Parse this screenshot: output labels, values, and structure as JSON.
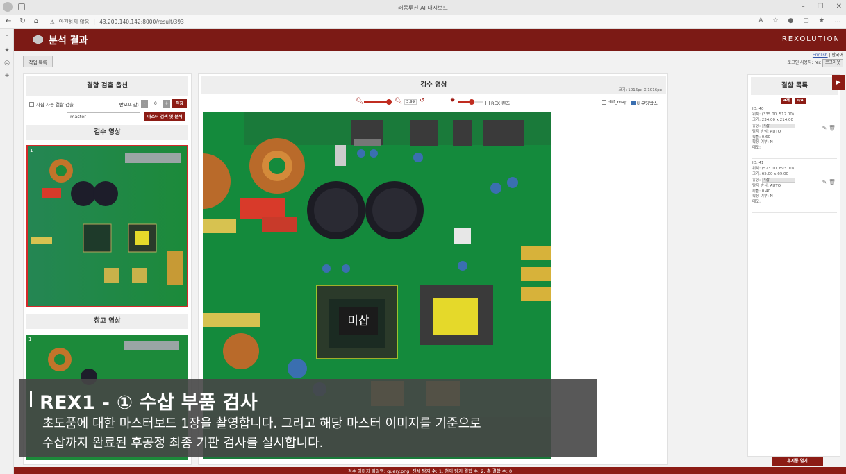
{
  "browser": {
    "tab_title": "래몽루션 AI 대시보드",
    "security_label": "안전하지 않음",
    "url": "43.200.140.142:8000/result/393"
  },
  "header": {
    "title": "분석 결과",
    "brand": "REXOLUTION"
  },
  "toolbar": {
    "job_list_label": "작업 목록"
  },
  "user": {
    "lang_en": "English",
    "lang_sep": " | ",
    "lang_ko": "한국어",
    "login_label": "로그인 사용자: rex",
    "logout_label": "로그아웃"
  },
  "options": {
    "title": "결함 검출 옵션",
    "auto_checkbox_label": "자삽 자동 결함 검출",
    "threshold_label": "반오프 값:",
    "threshold_minus": "-",
    "threshold_value": "0",
    "threshold_plus": "+",
    "save_label": "저장",
    "master_value": "master",
    "search_analyze_label": "마스터 검색 및 분석"
  },
  "inspection": {
    "title": "검수 영상",
    "index": "1"
  },
  "reference": {
    "title": "참고 영상",
    "index": "1"
  },
  "viewer": {
    "title": "검수 영상",
    "size_label": "크기: 1016px X 1016px",
    "zoom_value": "3.99",
    "rex_lens_label": "REX 렌즈",
    "diff_map_label": "diff_map",
    "bbox_label": "바운딩박스",
    "defect_overlay_text": "미삽"
  },
  "defects": {
    "title": "결함 목록",
    "count_badge": "4개",
    "page_badge": "1/4",
    "items": [
      {
        "id": "ID: 40",
        "position": "위치: (335.00, 512.00)",
        "size": "크기: 234.00 x 214.00",
        "type_label": "유형:",
        "type_value": "미삽",
        "method": "탐지 방식: AUTO",
        "prob": "확률: 0.60",
        "confirmed": "확정 여부: N",
        "memo": "메모:"
      },
      {
        "id": "ID: 41",
        "position": "위치: (523.00, 893.00)",
        "size": "크기: 65.00 x 69.00",
        "type_label": "유형:",
        "type_value": "미삽",
        "method": "탐지 방식: AUTO",
        "prob": "확률: 0.40",
        "confirmed": "확정 여부: N",
        "memo": "메모:"
      }
    ],
    "open_trash_label": "휴지통 열기"
  },
  "status": {
    "text": "검수 이미지 파일명: query.png, 전체 탐지 수: 1, 현재 탐지 결함 수: 2, 총 결함 수: 0"
  },
  "subtitle": {
    "title": "REX1 - ① 수삽 부품 검사",
    "line1": "초도품에 대한 마스터보드 1장을 촬영합니다. 그리고 해당 마스터 이미지를 기준으로",
    "line2": "수삽까지 완료된 후공정 최종 기판 검사를 실시합니다."
  },
  "colors": {
    "brand_red": "#7c1a15",
    "pcb_green": "#1c8a3a"
  }
}
